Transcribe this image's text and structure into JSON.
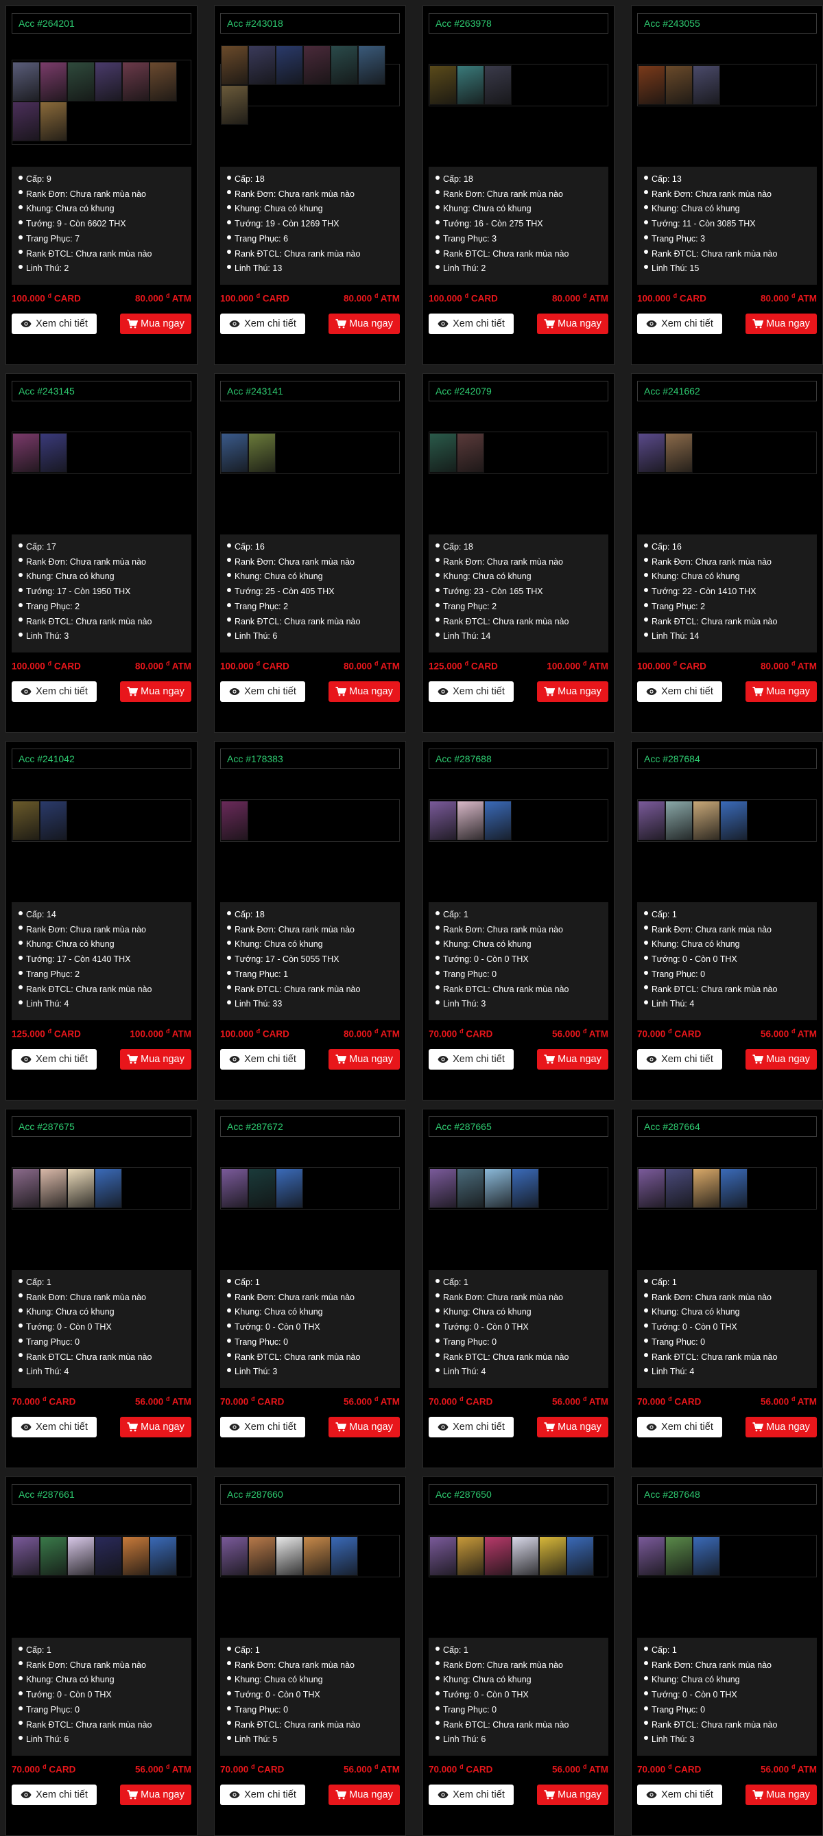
{
  "labels": {
    "view_detail": "Xem chi tiết",
    "buy_now": "Mua ngay"
  },
  "icons": {
    "view": "eye-icon",
    "buy": "cart-icon"
  },
  "colors": {
    "id": "#2ecc71",
    "price": "#e8161b",
    "buy_button": "#e8161b"
  },
  "accounts": [
    {
      "id": "Acc #264201",
      "champ_count": 8,
      "champ_colors": [
        "#5a5d7a",
        "#7a3c6a",
        "#2f4a3c",
        "#4a3b6b",
        "#6b3a4a",
        "#6b4a2f",
        "#4b2f5a",
        "#8a6a3a"
      ],
      "stats": [
        "Cấp: 9",
        "Rank Đơn: Chưa rank mùa nào",
        "Khung: Chưa có khung",
        "Tướng: 9 - Còn 6602 THX",
        "Trang Phục: 7",
        "Rank ĐTCL: Chưa rank mùa nào",
        "Linh Thú: 2"
      ],
      "card_price": "100.000",
      "atm_price": "80.000",
      "currency": "đ",
      "card_label": "CARD",
      "atm_label": "ATM"
    },
    {
      "id": "Acc #243018",
      "champ_count": 7,
      "champ_colors": [
        "#6a4a2a",
        "#3a3a5a",
        "#2a3a6a",
        "#4a2a3a",
        "#2a4a4a",
        "#3a5a7a",
        "#6a5a3a"
      ],
      "stats": [
        "Cấp: 18",
        "Rank Đơn: Chưa rank mùa nào",
        "Khung: Chưa có khung",
        "Tướng: 19 - Còn 1269 THX",
        "Trang Phục: 6",
        "Rank ĐTCL: Chưa rank mùa nào",
        "Linh Thú: 13"
      ],
      "card_price": "100.000",
      "atm_price": "80.000",
      "currency": "đ",
      "card_label": "CARD",
      "atm_label": "ATM"
    },
    {
      "id": "Acc #263978",
      "champ_count": 3,
      "champ_colors": [
        "#5a4a1a",
        "#3a7a7a",
        "#3a3a4a"
      ],
      "stats": [
        "Cấp: 18",
        "Rank Đơn: Chưa rank mùa nào",
        "Khung: Chưa có khung",
        "Tướng: 16 - Còn 275 THX",
        "Trang Phục: 3",
        "Rank ĐTCL: Chưa rank mùa nào",
        "Linh Thú: 2"
      ],
      "card_price": "100.000",
      "atm_price": "80.000",
      "currency": "đ",
      "card_label": "CARD",
      "atm_label": "ATM"
    },
    {
      "id": "Acc #243055",
      "champ_count": 3,
      "champ_colors": [
        "#7a3a1a",
        "#6a4a2a",
        "#4a4a6a"
      ],
      "stats": [
        "Cấp: 13",
        "Rank Đơn: Chưa rank mùa nào",
        "Khung: Chưa có khung",
        "Tướng: 11 - Còn 3085 THX",
        "Trang Phục: 3",
        "Rank ĐTCL: Chưa rank mùa nào",
        "Linh Thú: 15"
      ],
      "card_price": "100.000",
      "atm_price": "80.000",
      "currency": "đ",
      "card_label": "CARD",
      "atm_label": "ATM"
    },
    {
      "id": "Acc #243145",
      "champ_count": 2,
      "champ_colors": [
        "#7a3a6a",
        "#3a3a7a"
      ],
      "stats": [
        "Cấp: 17",
        "Rank Đơn: Chưa rank mùa nào",
        "Khung: Chưa có khung",
        "Tướng: 17 - Còn 1950 THX",
        "Trang Phục: 2",
        "Rank ĐTCL: Chưa rank mùa nào",
        "Linh Thú: 3"
      ],
      "card_price": "100.000",
      "atm_price": "80.000",
      "currency": "đ",
      "card_label": "CARD",
      "atm_label": "ATM"
    },
    {
      "id": "Acc #243141",
      "champ_count": 2,
      "champ_colors": [
        "#3a5a8a",
        "#6a7a3a"
      ],
      "stats": [
        "Cấp: 16",
        "Rank Đơn: Chưa rank mùa nào",
        "Khung: Chưa có khung",
        "Tướng: 25 - Còn 405 THX",
        "Trang Phục: 2",
        "Rank ĐTCL: Chưa rank mùa nào",
        "Linh Thú: 6"
      ],
      "card_price": "100.000",
      "atm_price": "80.000",
      "currency": "đ",
      "card_label": "CARD",
      "atm_label": "ATM"
    },
    {
      "id": "Acc #242079",
      "champ_count": 2,
      "champ_colors": [
        "#2a5a4a",
        "#5a3a3a"
      ],
      "stats": [
        "Cấp: 18",
        "Rank Đơn: Chưa rank mùa nào",
        "Khung: Chưa có khung",
        "Tướng: 23 - Còn 165 THX",
        "Trang Phục: 2",
        "Rank ĐTCL: Chưa rank mùa nào",
        "Linh Thú: 14"
      ],
      "card_price": "125.000",
      "atm_price": "100.000",
      "currency": "đ",
      "card_label": "CARD",
      "atm_label": "ATM"
    },
    {
      "id": "Acc #241662",
      "champ_count": 2,
      "champ_colors": [
        "#5a4a8a",
        "#8a6a4a"
      ],
      "stats": [
        "Cấp: 16",
        "Rank Đơn: Chưa rank mùa nào",
        "Khung: Chưa có khung",
        "Tướng: 22 - Còn 1410 THX",
        "Trang Phục: 2",
        "Rank ĐTCL: Chưa rank mùa nào",
        "Linh Thú: 14"
      ],
      "card_price": "100.000",
      "atm_price": "80.000",
      "currency": "đ",
      "card_label": "CARD",
      "atm_label": "ATM"
    },
    {
      "id": "Acc #241042",
      "champ_count": 2,
      "champ_colors": [
        "#6a5a2a",
        "#2a3a6a"
      ],
      "stats": [
        "Cấp: 14",
        "Rank Đơn: Chưa rank mùa nào",
        "Khung: Chưa có khung",
        "Tướng: 17 - Còn 4140 THX",
        "Trang Phục: 2",
        "Rank ĐTCL: Chưa rank mùa nào",
        "Linh Thú: 4"
      ],
      "card_price": "125.000",
      "atm_price": "100.000",
      "currency": "đ",
      "card_label": "CARD",
      "atm_label": "ATM"
    },
    {
      "id": "Acc #178383",
      "champ_count": 1,
      "champ_colors": [
        "#6a2a5a"
      ],
      "stats": [
        "Cấp: 18",
        "Rank Đơn: Chưa rank mùa nào",
        "Khung: Chưa có khung",
        "Tướng: 17 - Còn 5055 THX",
        "Trang Phục: 1",
        "Rank ĐTCL: Chưa rank mùa nào",
        "Linh Thú: 33"
      ],
      "card_price": "100.000",
      "atm_price": "80.000",
      "currency": "đ",
      "card_label": "CARD",
      "atm_label": "ATM"
    },
    {
      "id": "Acc #287688",
      "champ_count": 3,
      "champ_colors": [
        "#7a5a9a",
        "#d8b8c8",
        "#3a6ab8"
      ],
      "stats": [
        "Cấp: 1",
        "Rank Đơn: Chưa rank mùa nào",
        "Khung: Chưa có khung",
        "Tướng: 0 - Còn 0 THX",
        "Trang Phục: 0",
        "Rank ĐTCL: Chưa rank mùa nào",
        "Linh Thú: 3"
      ],
      "card_price": "70.000",
      "atm_price": "56.000",
      "currency": "đ",
      "card_label": "CARD",
      "atm_label": "ATM"
    },
    {
      "id": "Acc #287684",
      "champ_count": 4,
      "champ_colors": [
        "#7a5a9a",
        "#8aa8a8",
        "#c8a878",
        "#3a6ab8"
      ],
      "stats": [
        "Cấp: 1",
        "Rank Đơn: Chưa rank mùa nào",
        "Khung: Chưa có khung",
        "Tướng: 0 - Còn 0 THX",
        "Trang Phục: 0",
        "Rank ĐTCL: Chưa rank mùa nào",
        "Linh Thú: 4"
      ],
      "card_price": "70.000",
      "atm_price": "56.000",
      "currency": "đ",
      "card_label": "CARD",
      "atm_label": "ATM"
    },
    {
      "id": "Acc #287675",
      "champ_count": 4,
      "champ_colors": [
        "#8a6a8a",
        "#d8b8a8",
        "#e8d8b8",
        "#3a6ab8"
      ],
      "stats": [
        "Cấp: 1",
        "Rank Đơn: Chưa rank mùa nào",
        "Khung: Chưa có khung",
        "Tướng: 0 - Còn 0 THX",
        "Trang Phục: 0",
        "Rank ĐTCL: Chưa rank mùa nào",
        "Linh Thú: 4"
      ],
      "card_price": "70.000",
      "atm_price": "56.000",
      "currency": "đ",
      "card_label": "CARD",
      "atm_label": "ATM"
    },
    {
      "id": "Acc #287672",
      "champ_count": 3,
      "champ_colors": [
        "#7a5a9a",
        "#1a3a3a",
        "#3a6ab8"
      ],
      "stats": [
        "Cấp: 1",
        "Rank Đơn: Chưa rank mùa nào",
        "Khung: Chưa có khung",
        "Tướng: 0 - Còn 0 THX",
        "Trang Phục: 0",
        "Rank ĐTCL: Chưa rank mùa nào",
        "Linh Thú: 3"
      ],
      "card_price": "70.000",
      "atm_price": "56.000",
      "currency": "đ",
      "card_label": "CARD",
      "atm_label": "ATM"
    },
    {
      "id": "Acc #287665",
      "champ_count": 4,
      "champ_colors": [
        "#7a5a9a",
        "#4a6a7a",
        "#8ab8d8",
        "#3a6ab8"
      ],
      "stats": [
        "Cấp: 1",
        "Rank Đơn: Chưa rank mùa nào",
        "Khung: Chưa có khung",
        "Tướng: 0 - Còn 0 THX",
        "Trang Phục: 0",
        "Rank ĐTCL: Chưa rank mùa nào",
        "Linh Thú: 4"
      ],
      "card_price": "70.000",
      "atm_price": "56.000",
      "currency": "đ",
      "card_label": "CARD",
      "atm_label": "ATM"
    },
    {
      "id": "Acc #287664",
      "champ_count": 4,
      "champ_colors": [
        "#7a5a9a",
        "#4a4a7a",
        "#d8a868",
        "#3a6ab8"
      ],
      "stats": [
        "Cấp: 1",
        "Rank Đơn: Chưa rank mùa nào",
        "Khung: Chưa có khung",
        "Tướng: 0 - Còn 0 THX",
        "Trang Phục: 0",
        "Rank ĐTCL: Chưa rank mùa nào",
        "Linh Thú: 4"
      ],
      "card_price": "70.000",
      "atm_price": "56.000",
      "currency": "đ",
      "card_label": "CARD",
      "atm_label": "ATM"
    },
    {
      "id": "Acc #287661",
      "champ_count": 6,
      "champ_colors": [
        "#7a5a9a",
        "#3a7a4a",
        "#d8c8e8",
        "#2a2a5a",
        "#c87a3a",
        "#3a6ab8"
      ],
      "stats": [
        "Cấp: 1",
        "Rank Đơn: Chưa rank mùa nào",
        "Khung: Chưa có khung",
        "Tướng: 0 - Còn 0 THX",
        "Trang Phục: 0",
        "Rank ĐTCL: Chưa rank mùa nào",
        "Linh Thú: 6"
      ],
      "card_price": "70.000",
      "atm_price": "56.000",
      "currency": "đ",
      "card_label": "CARD",
      "atm_label": "ATM"
    },
    {
      "id": "Acc #287660",
      "champ_count": 5,
      "champ_colors": [
        "#7a5a9a",
        "#b87a4a",
        "#e8e8e8",
        "#c88a4a",
        "#3a6ab8"
      ],
      "stats": [
        "Cấp: 1",
        "Rank Đơn: Chưa rank mùa nào",
        "Khung: Chưa có khung",
        "Tướng: 0 - Còn 0 THX",
        "Trang Phục: 0",
        "Rank ĐTCL: Chưa rank mùa nào",
        "Linh Thú: 5"
      ],
      "card_price": "70.000",
      "atm_price": "56.000",
      "currency": "đ",
      "card_label": "CARD",
      "atm_label": "ATM"
    },
    {
      "id": "Acc #287650",
      "champ_count": 6,
      "champ_colors": [
        "#7a5a9a",
        "#c89a3a",
        "#b83a6a",
        "#d8d8e8",
        "#d8b83a",
        "#3a6ab8"
      ],
      "stats": [
        "Cấp: 1",
        "Rank Đơn: Chưa rank mùa nào",
        "Khung: Chưa có khung",
        "Tướng: 0 - Còn 0 THX",
        "Trang Phục: 0",
        "Rank ĐTCL: Chưa rank mùa nào",
        "Linh Thú: 6"
      ],
      "card_price": "70.000",
      "atm_price": "56.000",
      "currency": "đ",
      "card_label": "CARD",
      "atm_label": "ATM"
    },
    {
      "id": "Acc #287648",
      "champ_count": 3,
      "champ_colors": [
        "#7a5a9a",
        "#5a8a4a",
        "#3a6ab8"
      ],
      "stats": [
        "Cấp: 1",
        "Rank Đơn: Chưa rank mùa nào",
        "Khung: Chưa có khung",
        "Tướng: 0 - Còn 0 THX",
        "Trang Phục: 0",
        "Rank ĐTCL: Chưa rank mùa nào",
        "Linh Thú: 3"
      ],
      "card_price": "70.000",
      "atm_price": "56.000",
      "currency": "đ",
      "card_label": "CARD",
      "atm_label": "ATM"
    }
  ]
}
